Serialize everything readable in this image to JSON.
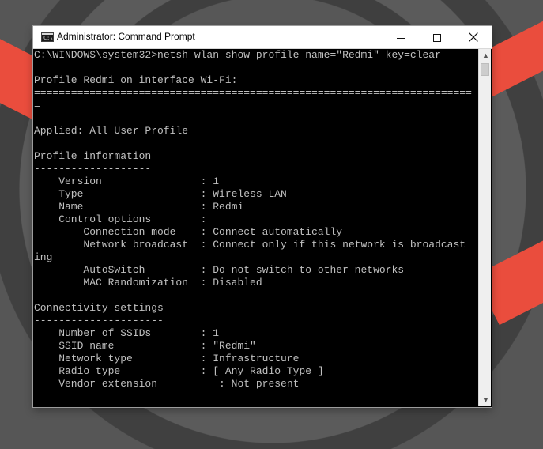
{
  "window": {
    "title": "Administrator: Command Prompt",
    "icon_text": "C:\\",
    "controls": {
      "minimize_icon": "minimize-icon",
      "maximize_icon": "maximize-icon",
      "close_icon": "close-icon"
    }
  },
  "console": {
    "lines": [
      "C:\\WINDOWS\\system32>netsh wlan show profile name=\"Redmi\" key=clear",
      "",
      "Profile Redmi on interface Wi-Fi:",
      "=======================================================================",
      "=",
      "",
      "Applied: All User Profile",
      "",
      "Profile information",
      "-------------------",
      "    Version                : 1",
      "    Type                   : Wireless LAN",
      "    Name                   : Redmi",
      "    Control options        :",
      "        Connection mode    : Connect automatically",
      "        Network broadcast  : Connect only if this network is broadcast",
      "ing",
      "        AutoSwitch         : Do not switch to other networks",
      "        MAC Randomization  : Disabled",
      "",
      "Connectivity settings",
      "---------------------",
      "    Number of SSIDs        : 1",
      "    SSID name              : \"Redmi\"",
      "    Network type           : Infrastructure",
      "    Radio type             : [ Any Radio Type ]",
      "    Vendor extension          : Not present"
    ]
  },
  "colors": {
    "console_background": "#000000",
    "console_text": "#c0c0c0",
    "titlebar_background": "#ffffff",
    "desktop_accent": "#ea4d3d"
  }
}
